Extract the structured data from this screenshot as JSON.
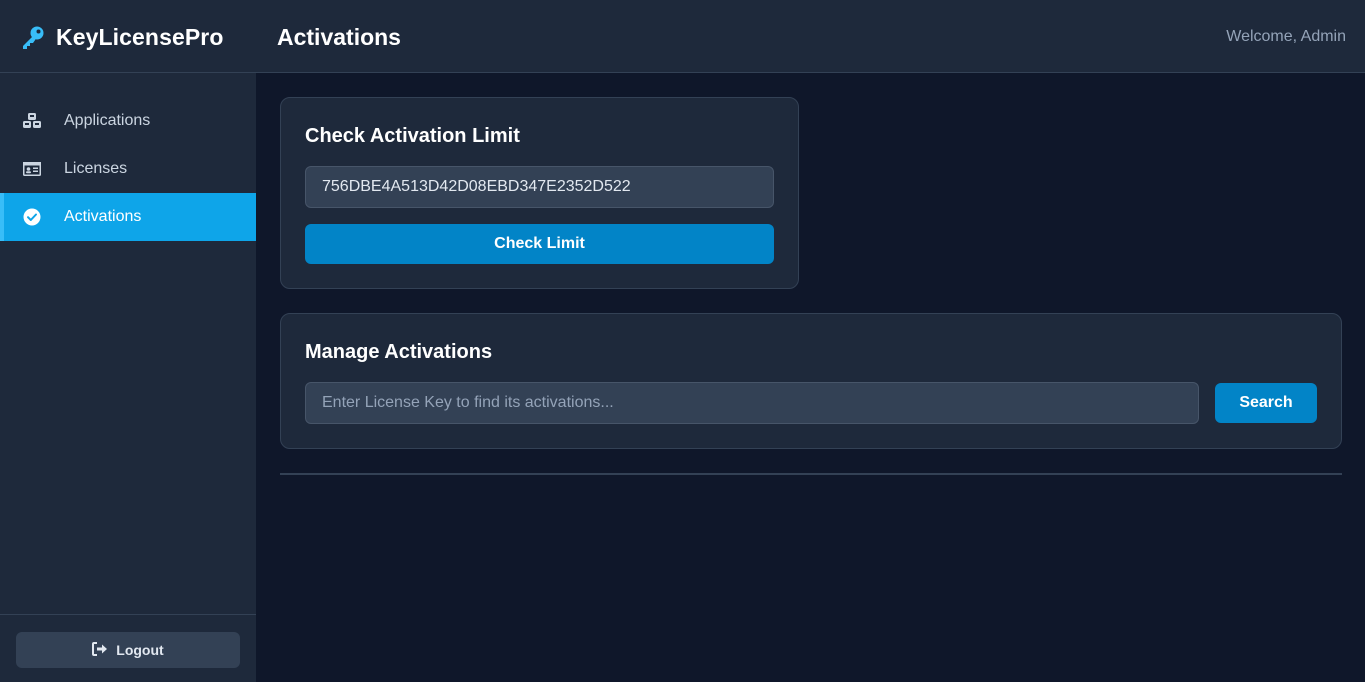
{
  "brand": {
    "name": "KeyLicensePro",
    "icon": "key-icon"
  },
  "header": {
    "title": "Activations",
    "welcome": "Welcome, Admin"
  },
  "sidebar": {
    "items": [
      {
        "label": "Applications",
        "icon": "cubes-icon",
        "active": false
      },
      {
        "label": "Licenses",
        "icon": "id-card-icon",
        "active": false
      },
      {
        "label": "Activations",
        "icon": "check-circle-icon",
        "active": true
      }
    ],
    "logout_label": "Logout"
  },
  "check_limit": {
    "title": "Check Activation Limit",
    "input_value": "756DBE4A513D42D08EBD347E2352D522",
    "button_label": "Check Limit"
  },
  "manage": {
    "title": "Manage Activations",
    "placeholder": "Enter License Key to find its activations...",
    "button_label": "Search"
  },
  "colors": {
    "background": "#0f172a",
    "panel": "#1e293b",
    "accent": "#0ea5e9",
    "button": "#0284c7",
    "brand_icon": "#38bdf8"
  }
}
